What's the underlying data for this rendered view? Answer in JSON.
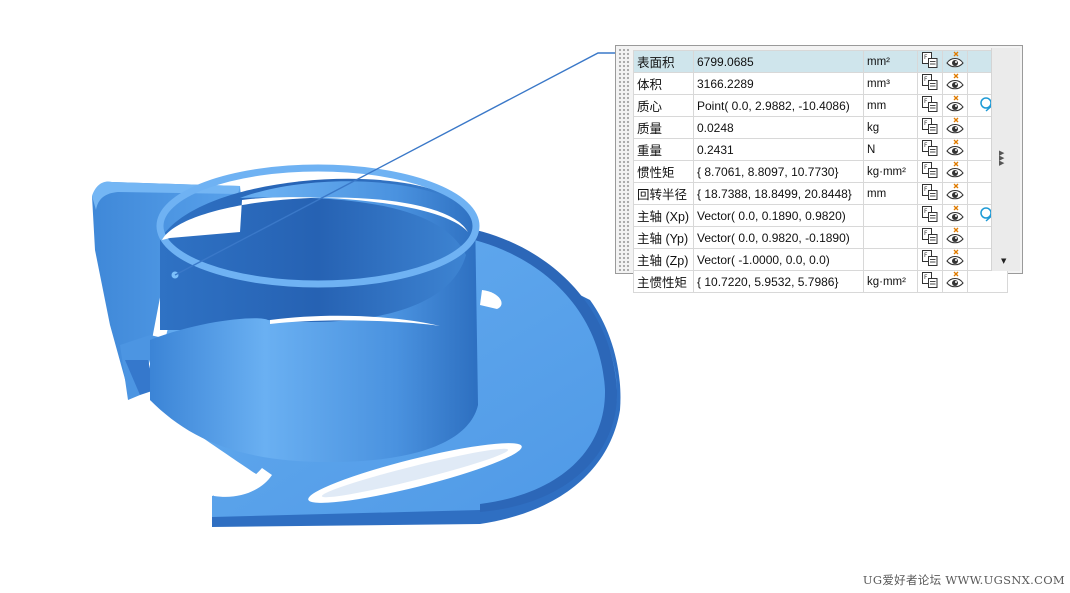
{
  "measurements": [
    {
      "name": "表面积",
      "value": "6799.0685",
      "unit": "mm²",
      "selected": true,
      "extra_icon": false
    },
    {
      "name": "体积",
      "value": "3166.2289",
      "unit": "mm³",
      "selected": false,
      "extra_icon": false
    },
    {
      "name": "质心",
      "value": "Point( 0.0, 2.9882, -10.4086)",
      "unit": "mm",
      "selected": false,
      "extra_icon": true
    },
    {
      "name": "质量",
      "value": "0.0248",
      "unit": "kg",
      "selected": false,
      "extra_icon": false
    },
    {
      "name": "重量",
      "value": "0.2431",
      "unit": "N",
      "selected": false,
      "extra_icon": false
    },
    {
      "name": "惯性矩",
      "value": "{ 8.7061, 8.8097, 10.7730}",
      "unit": "kg·mm²",
      "selected": false,
      "extra_icon": false
    },
    {
      "name": "回转半径",
      "value": "{ 18.7388, 18.8499, 20.8448}",
      "unit": "mm",
      "selected": false,
      "extra_icon": false
    },
    {
      "name": "主轴 (Xp)",
      "value": "Vector( 0.0, 0.1890, 0.9820)",
      "unit": "",
      "selected": false,
      "extra_icon": true
    },
    {
      "name": "主轴 (Yp)",
      "value": "Vector( 0.0, 0.9820, -0.1890)",
      "unit": "",
      "selected": false,
      "extra_icon": false
    },
    {
      "name": "主轴 (Zp)",
      "value": "Vector( -1.0000, 0.0, 0.0)",
      "unit": "",
      "selected": false,
      "extra_icon": false
    },
    {
      "name": "主惯性矩",
      "value": "{ 10.7220, 5.9532, 5.7986}",
      "unit": "kg·mm²",
      "selected": false,
      "extra_icon": false
    }
  ],
  "icons": {
    "export": "export-to-expression-icon",
    "visibility": "show-hide-icon",
    "extra": "display-axis-icon",
    "more": "more-options-icon",
    "scroll": "scroll-down-icon"
  },
  "colors": {
    "part_light": "#5ea7ee",
    "part_mid": "#3f87d6",
    "part_dark": "#2b65b3",
    "leader_line": "#3a78c8",
    "selected_row": "#cfe5ec",
    "icon_accent": "#1e9ad6"
  },
  "watermark": "UG爱好者论坛 WWW.UGSNX.COM"
}
